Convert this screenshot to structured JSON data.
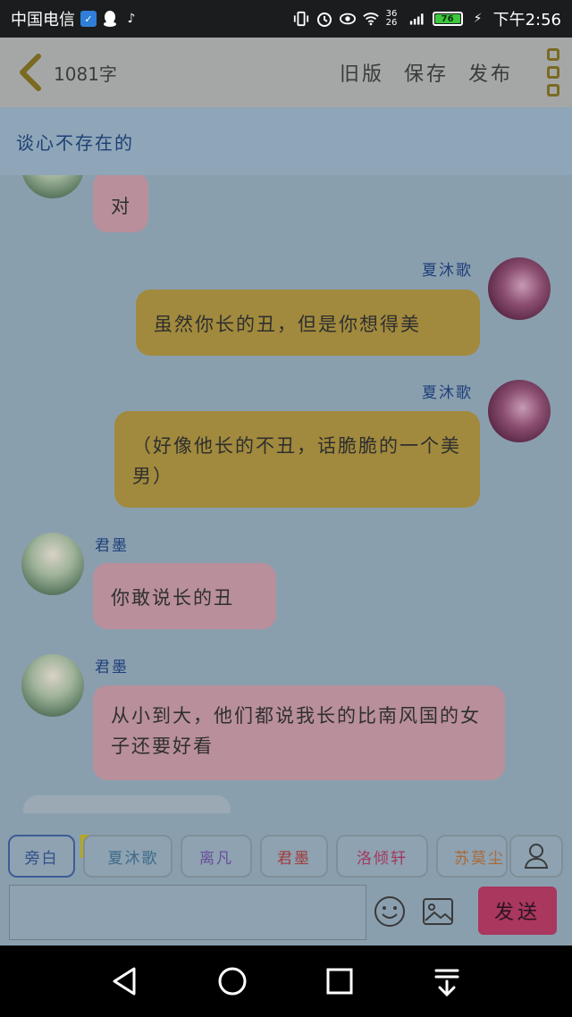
{
  "status_bar": {
    "carrier": "中国电信",
    "time": "下午2:56",
    "battery": "76",
    "signal": "36 26",
    "icons": [
      "shield-icon",
      "qq-icon",
      "tiktok-icon",
      "vibrate-icon",
      "alarm-icon",
      "eye-icon",
      "wifi-icon",
      "signal-icon",
      "battery-icon",
      "charging-icon"
    ]
  },
  "header": {
    "word_count": "1081字",
    "actions": [
      "旧版",
      "保存",
      "发布"
    ]
  },
  "title": "谈心不存在的",
  "messages": [
    {
      "speaker": "",
      "side": "left",
      "text": "对"
    },
    {
      "speaker": "夏沐歌",
      "side": "right",
      "text": "虽然你长的丑，但是你想得美"
    },
    {
      "speaker": "夏沐歌",
      "side": "right",
      "text": "（好像他长的不丑，话脆脆的一个美男）"
    },
    {
      "speaker": "君墨",
      "side": "left",
      "text": "你敢说长的丑"
    },
    {
      "speaker": "君墨",
      "side": "left",
      "text": "从小到大，他们都说我长的比南风国的女子还要好看"
    }
  ],
  "roles": [
    {
      "label": "旁白",
      "color": "#2f4f8a",
      "active": true
    },
    {
      "label": "夏沐歌",
      "color": "#3d6a8a",
      "host": true
    },
    {
      "label": "离凡",
      "color": "#6a4f9a"
    },
    {
      "label": "君墨",
      "color": "#a33a3a"
    },
    {
      "label": "洛倾轩",
      "color": "#a3385e"
    },
    {
      "label": "苏莫尘",
      "color": "#a86a3a"
    }
  ],
  "host_tag": "主",
  "input": {
    "placeholder": "",
    "value": ""
  },
  "send_label": "发送",
  "colors": {
    "bubble_pink": "#b88f9b",
    "bubble_gold": "#a18a3d",
    "send": "#a9375e",
    "name": "#1e3f7a"
  }
}
